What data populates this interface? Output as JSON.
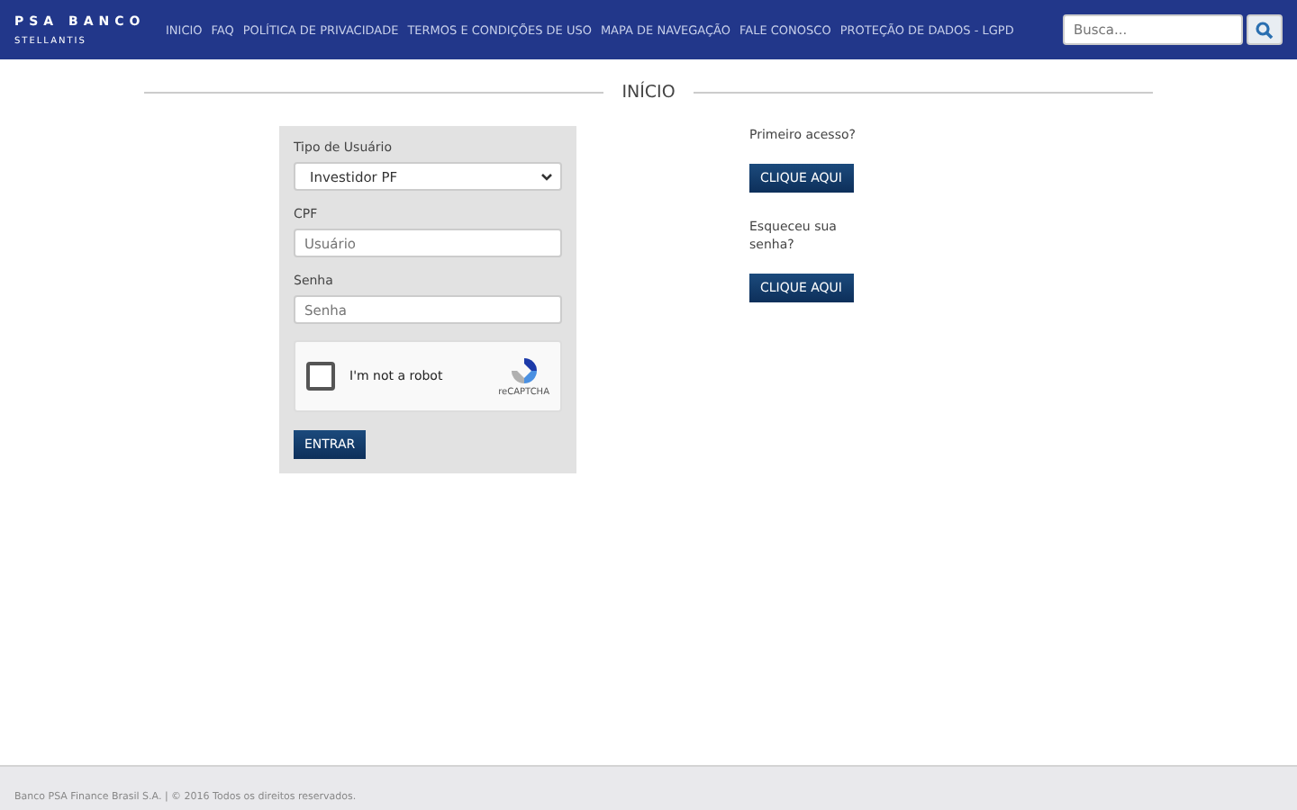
{
  "header": {
    "logo": {
      "title": "PSA BANCO",
      "subtitle": "STELLANTIS"
    },
    "nav": [
      "INICIO",
      "FAQ",
      "POLÍTICA DE PRIVACIDADE",
      "TERMOS E CONDIÇÕES DE USO",
      "MAPA DE NAVEGAÇÃO",
      "FALE CONOSCO",
      "PROTEÇÃO DE DADOS - LGPD"
    ],
    "search": {
      "placeholder": "Busca..."
    }
  },
  "page_title": "INÍCIO",
  "login_form": {
    "user_type": {
      "label": "Tipo de Usuário",
      "value": "Investidor PF"
    },
    "cpf": {
      "label": "CPF",
      "placeholder": "Usuário"
    },
    "password": {
      "label": "Senha",
      "placeholder": "Senha"
    },
    "captcha": {
      "label": "I'm not a robot",
      "brand": "reCAPTCHA",
      "checked": false
    },
    "submit": "ENTRAR"
  },
  "side_links": [
    {
      "text": "Primeiro acesso?",
      "button": "CLIQUE AQUI"
    },
    {
      "text": "Esqueceu sua senha?",
      "button": "CLIQUE AQUI"
    }
  ],
  "footer": "Banco PSA Finance Brasil S.A. | © 2016 Todos os direitos reservados."
}
